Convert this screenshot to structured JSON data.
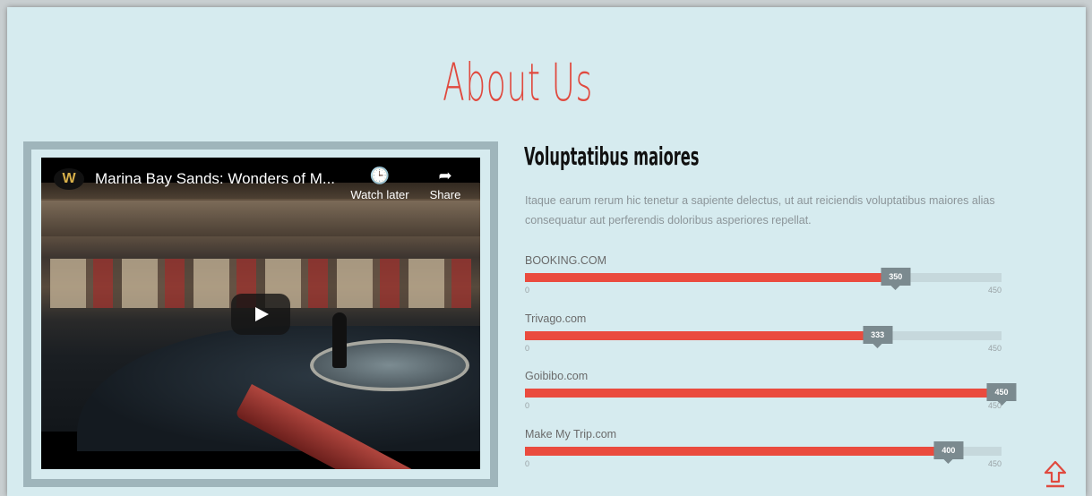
{
  "section": {
    "title": "About Us",
    "subtitle": "Voluptatibus maiores",
    "description": "Itaque earum rerum hic tenetur a sapiente delectus, ut aut reiciendis voluptatibus maiores alias consequatur aut perferendis doloribus asperiores repellat."
  },
  "video": {
    "logo": "W",
    "title": "Marina Bay Sands: Wonders of M...",
    "watch_later_label": "Watch later",
    "share_label": "Share",
    "icons": {
      "watch_later": "clock-icon",
      "share": "share-arrow-icon",
      "play": "play-icon"
    }
  },
  "skills": [
    {
      "label": "BOOKING.COM",
      "value": 350,
      "value_text": "350",
      "min": "0",
      "max": "450"
    },
    {
      "label": "Trivago.com",
      "value": 333,
      "value_text": "333",
      "min": "0",
      "max": "450"
    },
    {
      "label": "Goibibo.com",
      "value": 450,
      "value_text": "450",
      "min": "0",
      "max": "450"
    },
    {
      "label": "Make My Trip.com",
      "value": 400,
      "value_text": "400",
      "min": "0",
      "max": "450"
    }
  ],
  "colors": {
    "accent": "#e04a3f",
    "bar_fill": "#ea4b3e",
    "bar_track": "#c6d8dc",
    "badge": "#7b8a8f",
    "background": "#d6ebef"
  },
  "scroll_top_icon": "arrow-up-icon"
}
